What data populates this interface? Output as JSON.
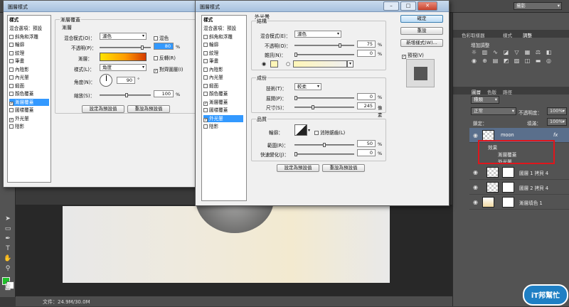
{
  "photoshop": {
    "workspace_dropdown": "攝影",
    "status_doc": "文件：24.9M/30.0M",
    "swatch_fg": "#1fbf2a",
    "swatch_bg": "#ffffff",
    "panel_tabs_top": [
      "色彩取樣器",
      "樣式",
      "調整"
    ],
    "adjust_add_label": "增加調整",
    "layers_tabs": [
      "圖層",
      "色版",
      "路徑"
    ],
    "kind_filter": "種類",
    "blend_mode": "正常",
    "opacity_label": "不透明度：",
    "opacity_value": "100%",
    "lock_label": "鎖定：",
    "fill_label": "填滿：",
    "fill_value": "100%",
    "layers": {
      "moon_name": "moon",
      "effects_label": "效果",
      "effect1": "漸層覆蓋",
      "effect2": "外光暈",
      "layer2": "圖層 1 拷貝 4",
      "layer3": "圖層 2 拷貝 4",
      "layer4": "漸層填色 1"
    },
    "fx_symbol": "fx",
    "logo_text": "iT邦幫忙"
  },
  "dialog1": {
    "title": "圖層樣式",
    "styles_header": "樣式",
    "styles": [
      {
        "label": "混合選項：預設",
        "checkbox": false,
        "checked": false,
        "selected": false
      },
      {
        "label": "斜角和浮雕",
        "checkbox": true,
        "checked": false,
        "selected": false
      },
      {
        "label": "輪廓",
        "checkbox": true,
        "checked": false,
        "selected": false
      },
      {
        "label": "紋理",
        "checkbox": true,
        "checked": false,
        "selected": false
      },
      {
        "label": "筆畫",
        "checkbox": true,
        "checked": false,
        "selected": false
      },
      {
        "label": "內陰影",
        "checkbox": true,
        "checked": false,
        "selected": false
      },
      {
        "label": "內光暈",
        "checkbox": true,
        "checked": false,
        "selected": false
      },
      {
        "label": "緞面",
        "checkbox": true,
        "checked": false,
        "selected": false
      },
      {
        "label": "顏色覆蓋",
        "checkbox": true,
        "checked": false,
        "selected": false
      },
      {
        "label": "漸層覆蓋",
        "checkbox": true,
        "checked": true,
        "selected": true
      },
      {
        "label": "圖樣覆蓋",
        "checkbox": true,
        "checked": false,
        "selected": false
      },
      {
        "label": "外光暈",
        "checkbox": true,
        "checked": true,
        "selected": false
      },
      {
        "label": "陰影",
        "checkbox": true,
        "checked": false,
        "selected": false
      }
    ],
    "section_title": "漸層覆蓋",
    "sub_title": "漸層",
    "blend_label": "混合模式(O)：",
    "blend_value": "濾色",
    "dither_label": "混色",
    "opacity_label": "不透明(P)：",
    "opacity_value": "80",
    "gradient_label": "漸層：",
    "reverse_label": "反轉(R)",
    "style_label": "樣式(L)：",
    "style_value": "角度",
    "align_label": "對齊圖層(I)",
    "angle_label": "角度(N)：",
    "angle_value": "90",
    "angle_unit": "°",
    "scale_label": "縮放(S)：",
    "scale_value": "100",
    "pct": "%",
    "btn_default": "設定為預設值",
    "btn_reset": "重設為預設值"
  },
  "dialog2": {
    "title": "圖層樣式",
    "styles_header": "樣式",
    "styles": [
      {
        "label": "混合選項：預設",
        "checkbox": false,
        "checked": false,
        "selected": false
      },
      {
        "label": "斜角和浮雕",
        "checkbox": true,
        "checked": false,
        "selected": false
      },
      {
        "label": "輪廓",
        "checkbox": true,
        "checked": false,
        "selected": false
      },
      {
        "label": "紋理",
        "checkbox": true,
        "checked": false,
        "selected": false
      },
      {
        "label": "筆畫",
        "checkbox": true,
        "checked": false,
        "selected": false
      },
      {
        "label": "內陰影",
        "checkbox": true,
        "checked": false,
        "selected": false
      },
      {
        "label": "內光暈",
        "checkbox": true,
        "checked": false,
        "selected": false
      },
      {
        "label": "緞面",
        "checkbox": true,
        "checked": false,
        "selected": false
      },
      {
        "label": "顏色覆蓋",
        "checkbox": true,
        "checked": false,
        "selected": false
      },
      {
        "label": "漸層覆蓋",
        "checkbox": true,
        "checked": true,
        "selected": false
      },
      {
        "label": "圖樣覆蓋",
        "checkbox": true,
        "checked": false,
        "selected": false
      },
      {
        "label": "外光暈",
        "checkbox": true,
        "checked": true,
        "selected": true
      },
      {
        "label": "陰影",
        "checkbox": true,
        "checked": false,
        "selected": false
      }
    ],
    "section_title": "外光暈",
    "structure_title": "結構",
    "blend_label": "混合模式(E)：",
    "blend_value": "濾色",
    "opacity_label": "不透明(O)：",
    "opacity_value": "75",
    "noise_label": "雜訊(N)：",
    "noise_value": "0",
    "glow_color": "#fff6b8",
    "elements_title": "成份",
    "technique_label": "技術(T)：",
    "technique_value": "較柔",
    "spread_label": "展開(P)：",
    "spread_value": "0",
    "size_label": "尺寸(S)：",
    "size_value": "245",
    "px_unit": "像素",
    "quality_title": "品質",
    "contour_label": "輪廓：",
    "antialias_label": "消除鋸齒(L)",
    "range_label": "範圍(R)：",
    "range_value": "50",
    "jitter_label": "快速變化(J)：",
    "jitter_value": "0",
    "pct": "%",
    "btn_default": "設定為預設值",
    "btn_reset": "重設為預設值",
    "btn_ok": "確定",
    "btn_cancel": "重設",
    "btn_new_style": "新增樣式(W)...",
    "preview_label": "預視(V)"
  }
}
